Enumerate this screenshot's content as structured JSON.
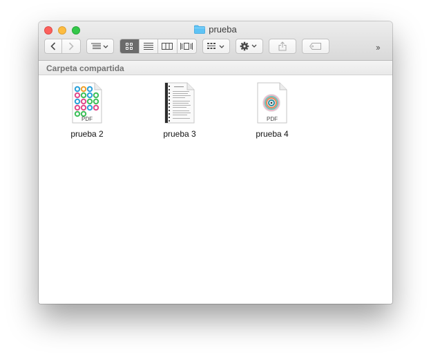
{
  "window": {
    "title": "prueba",
    "folder_icon": "folder-icon",
    "accent_folder_color": "#4ab8f0"
  },
  "toolbar": {
    "back_icon": "chevron-left-icon",
    "forward_icon": "chevron-right-icon",
    "arrange_icon": "arrange-menu-icon",
    "view_modes": [
      "icon-view-icon",
      "list-view-icon",
      "column-view-icon",
      "coverflow-view-icon"
    ],
    "active_view": "icon-view-icon",
    "group_icon": "group-icon",
    "action_icon": "gear-icon",
    "share_icon": "share-icon",
    "tag_icon": "tag-icon",
    "more": "››"
  },
  "pathbar": {
    "label": "Carpeta compartida"
  },
  "files": [
    {
      "name": "prueba 2",
      "badge": "PDF",
      "thumbnail": "pdf-circles-thumbnail"
    },
    {
      "name": "prueba 3",
      "badge": "",
      "thumbnail": "pdf-document-thumbnail"
    },
    {
      "name": "prueba 4",
      "badge": "PDF",
      "thumbnail": "pdf-emblem-thumbnail"
    }
  ]
}
